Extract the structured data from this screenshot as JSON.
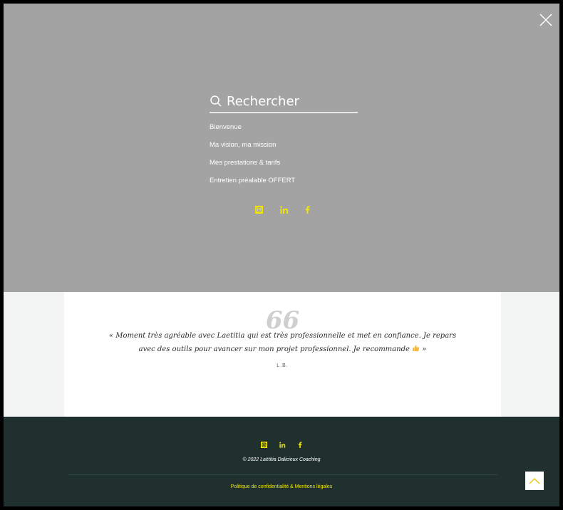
{
  "search": {
    "placeholder": "Rechercher"
  },
  "menu": {
    "items": [
      {
        "label": "Bienvenue"
      },
      {
        "label": "Ma vision, ma mission"
      },
      {
        "label": "Mes prestations & tarifs"
      },
      {
        "label": "Entretien préalable OFFERT"
      }
    ]
  },
  "social": {
    "icons": [
      "instagram-icon",
      "linkedin-icon",
      "facebook-icon"
    ],
    "color": "#f2e600"
  },
  "testimonial": {
    "quote_mark": "66",
    "text_before_emoji": "« Moment très agréable avec Laetitia qui est très professionnelle et met en confiance. Je repars avec des outils pour avancer sur mon projet professionnel. Je recommande",
    "text_after_emoji": "»",
    "author": "L.B."
  },
  "footer": {
    "copyright": "© 2022 Laëtitia Dalicieux Coaching",
    "policy_link": "Politique de confidentialité & Mentions légales"
  },
  "colors": {
    "overlay": "#a3a3a3",
    "footer_bg": "#1f302f",
    "accent": "#f2e600",
    "page_bg": "#f1f4f2"
  }
}
